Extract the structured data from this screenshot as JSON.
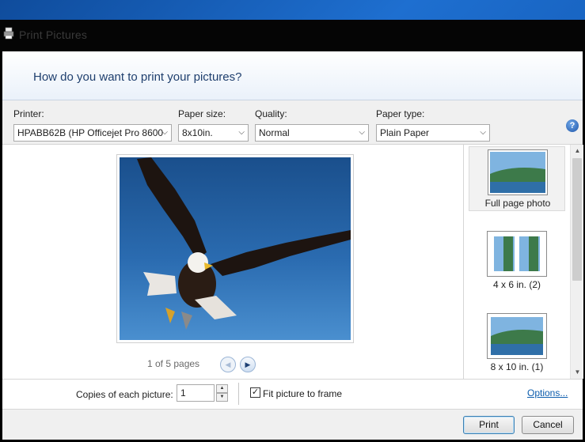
{
  "window": {
    "title": "Print Pictures"
  },
  "header": {
    "question": "How do you want to print your pictures?"
  },
  "options": {
    "printer": {
      "label": "Printer:",
      "value": "HPABB62B (HP Officejet Pro 8600"
    },
    "paper_size": {
      "label": "Paper size:",
      "value": "8x10in."
    },
    "quality": {
      "label": "Quality:",
      "value": "Normal"
    },
    "paper_type": {
      "label": "Paper type:",
      "value": "Plain Paper"
    },
    "help_icon": "?"
  },
  "preview": {
    "pager_text": "1 of 5 pages"
  },
  "layouts": {
    "items": [
      {
        "label": "Full page photo",
        "selected": true
      },
      {
        "label": "4 x 6 in. (2)",
        "selected": false
      },
      {
        "label": "8 x 10 in. (1)",
        "selected": false
      }
    ]
  },
  "copies": {
    "label": "Copies of each picture:",
    "value": "1",
    "fit_label": "Fit picture to frame",
    "fit_checked": true,
    "options_link": "Options..."
  },
  "buttons": {
    "print": "Print",
    "cancel": "Cancel"
  },
  "colors": {
    "header_text": "#1f3f6e",
    "link": "#0b5cad",
    "sky": "#2a6bb0"
  },
  "icons": {
    "title": "printer-icon",
    "help": "help-icon",
    "prev": "arrow-left-icon",
    "next": "arrow-right-icon"
  }
}
